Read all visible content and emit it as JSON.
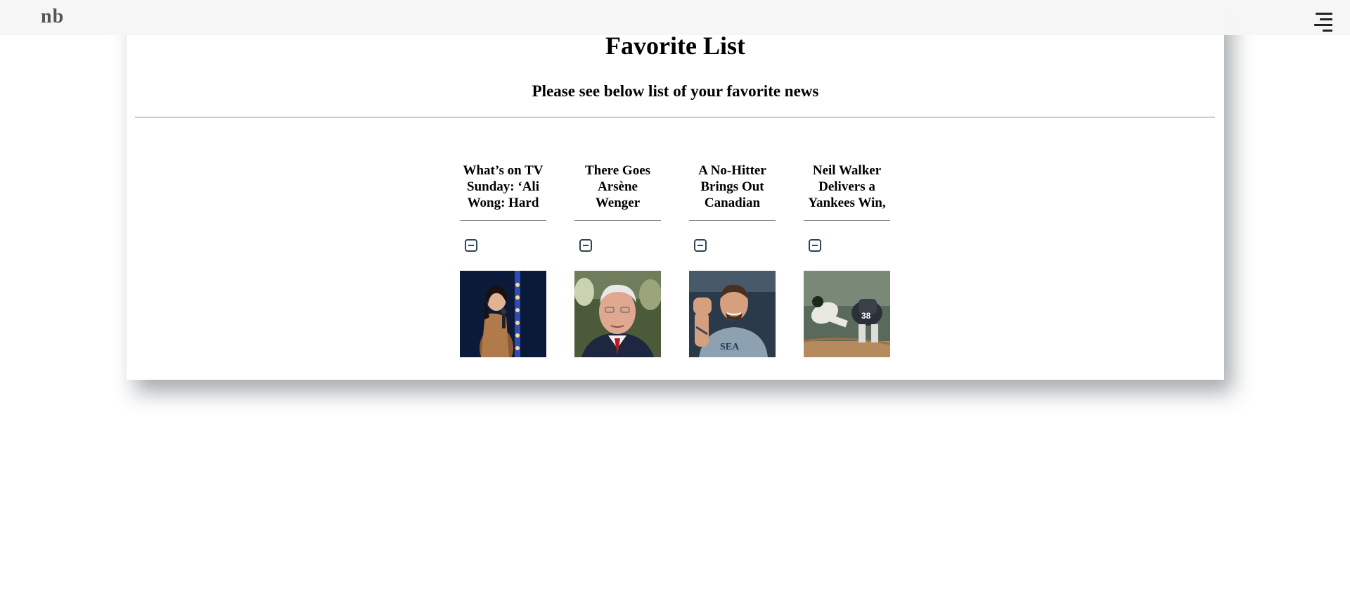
{
  "navbar": {
    "brand": "nb",
    "menu_icon": "hamburger-menu-icon"
  },
  "header": {
    "title": "Favorite List",
    "subtitle": "Please see below list of your favorite news"
  },
  "favorites": [
    {
      "title": "What’s on TV Sunday: ‘Ali Wong: Hard",
      "remove_icon": "minus-square-icon",
      "image": "woman-with-microphone-on-stage"
    },
    {
      "title": "There Goes Arsène Wenger",
      "remove_icon": "minus-square-icon",
      "image": "older-man-in-suit-portrait"
    },
    {
      "title": "A No-Hitter Brings Out Canadian",
      "remove_icon": "minus-square-icon",
      "image": "baseball-player-raising-fist"
    },
    {
      "title": "Neil Walker Delivers a Yankees Win,",
      "remove_icon": "minus-square-icon",
      "image": "baseball-slide-at-home-plate"
    }
  ]
}
